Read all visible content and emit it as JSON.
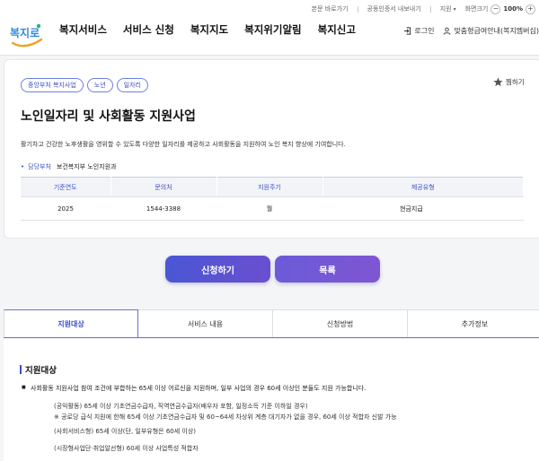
{
  "util": {
    "links": [
      "본문 바로가기",
      "공동인증서 내보내기"
    ],
    "language": "지원",
    "zoom_label": "화면크기",
    "zoom_value": "100%",
    "zoom_minus": "−",
    "zoom_plus": "+"
  },
  "header": {
    "logo_text": "복지로",
    "nav": [
      "복지서비스",
      "서비스 신청",
      "복지지도",
      "복지위기알림",
      "복지신고"
    ],
    "login": "로그인",
    "custom_guide": "맞춤형급여안내(복지멤버십)"
  },
  "service": {
    "tags": [
      "중앙부처 복지사업",
      "노년",
      "일자리"
    ],
    "favorite": "찜하기",
    "title": "노인일자리 및 사회활동 지원사업",
    "description": "활기차고 건강한 노후생활을 영위할 수 있도록 다양한 일자리를 제공하고 사회활동을 지원하여 노인 복지 향상에 기여합니다.",
    "dept_label": "담당부처",
    "dept_value": "보건복지부 노인지원과",
    "table": {
      "headers": [
        "기준연도",
        "문의처",
        "지원주기",
        "제공유형"
      ],
      "row": [
        "2025",
        "1544-3388",
        "월",
        "현금지급"
      ]
    }
  },
  "actions": {
    "apply": "신청하기",
    "list": "목록"
  },
  "tabs": [
    "지원대상",
    "서비스 내용",
    "신청방법",
    "추가정보"
  ],
  "content": {
    "section_title": "지원대상",
    "bullet": "사회활동 지원사업 참여 조건에 부합하는 65세 이상 어르신을 지원하며, 일부 사업의 경우 60세 이상인 분들도 지원 가능합니다.",
    "lines": [
      "(공익활동) 65세 이상 기초연금수급자, 직역연금수급자(배우자 포함, 일정소득 기준 이하일 경우)",
      "※ 공로당 급식 지원에 한해 65세 이상 기초연금수급자 및 60~64세 차상위 계층 대기자가 없을 경우, 60세 이상 적합자 신발 가능",
      "(사회서비스형) 65세 이상(단, 일부유형은 60세 이상)",
      "(시장형사업단·취업알선형) 60세 이상 사업특성 적합자"
    ]
  },
  "colors": {
    "accent": "#3b4fc4",
    "button_start": "#4a57d4",
    "button_end": "#7f55d2"
  }
}
